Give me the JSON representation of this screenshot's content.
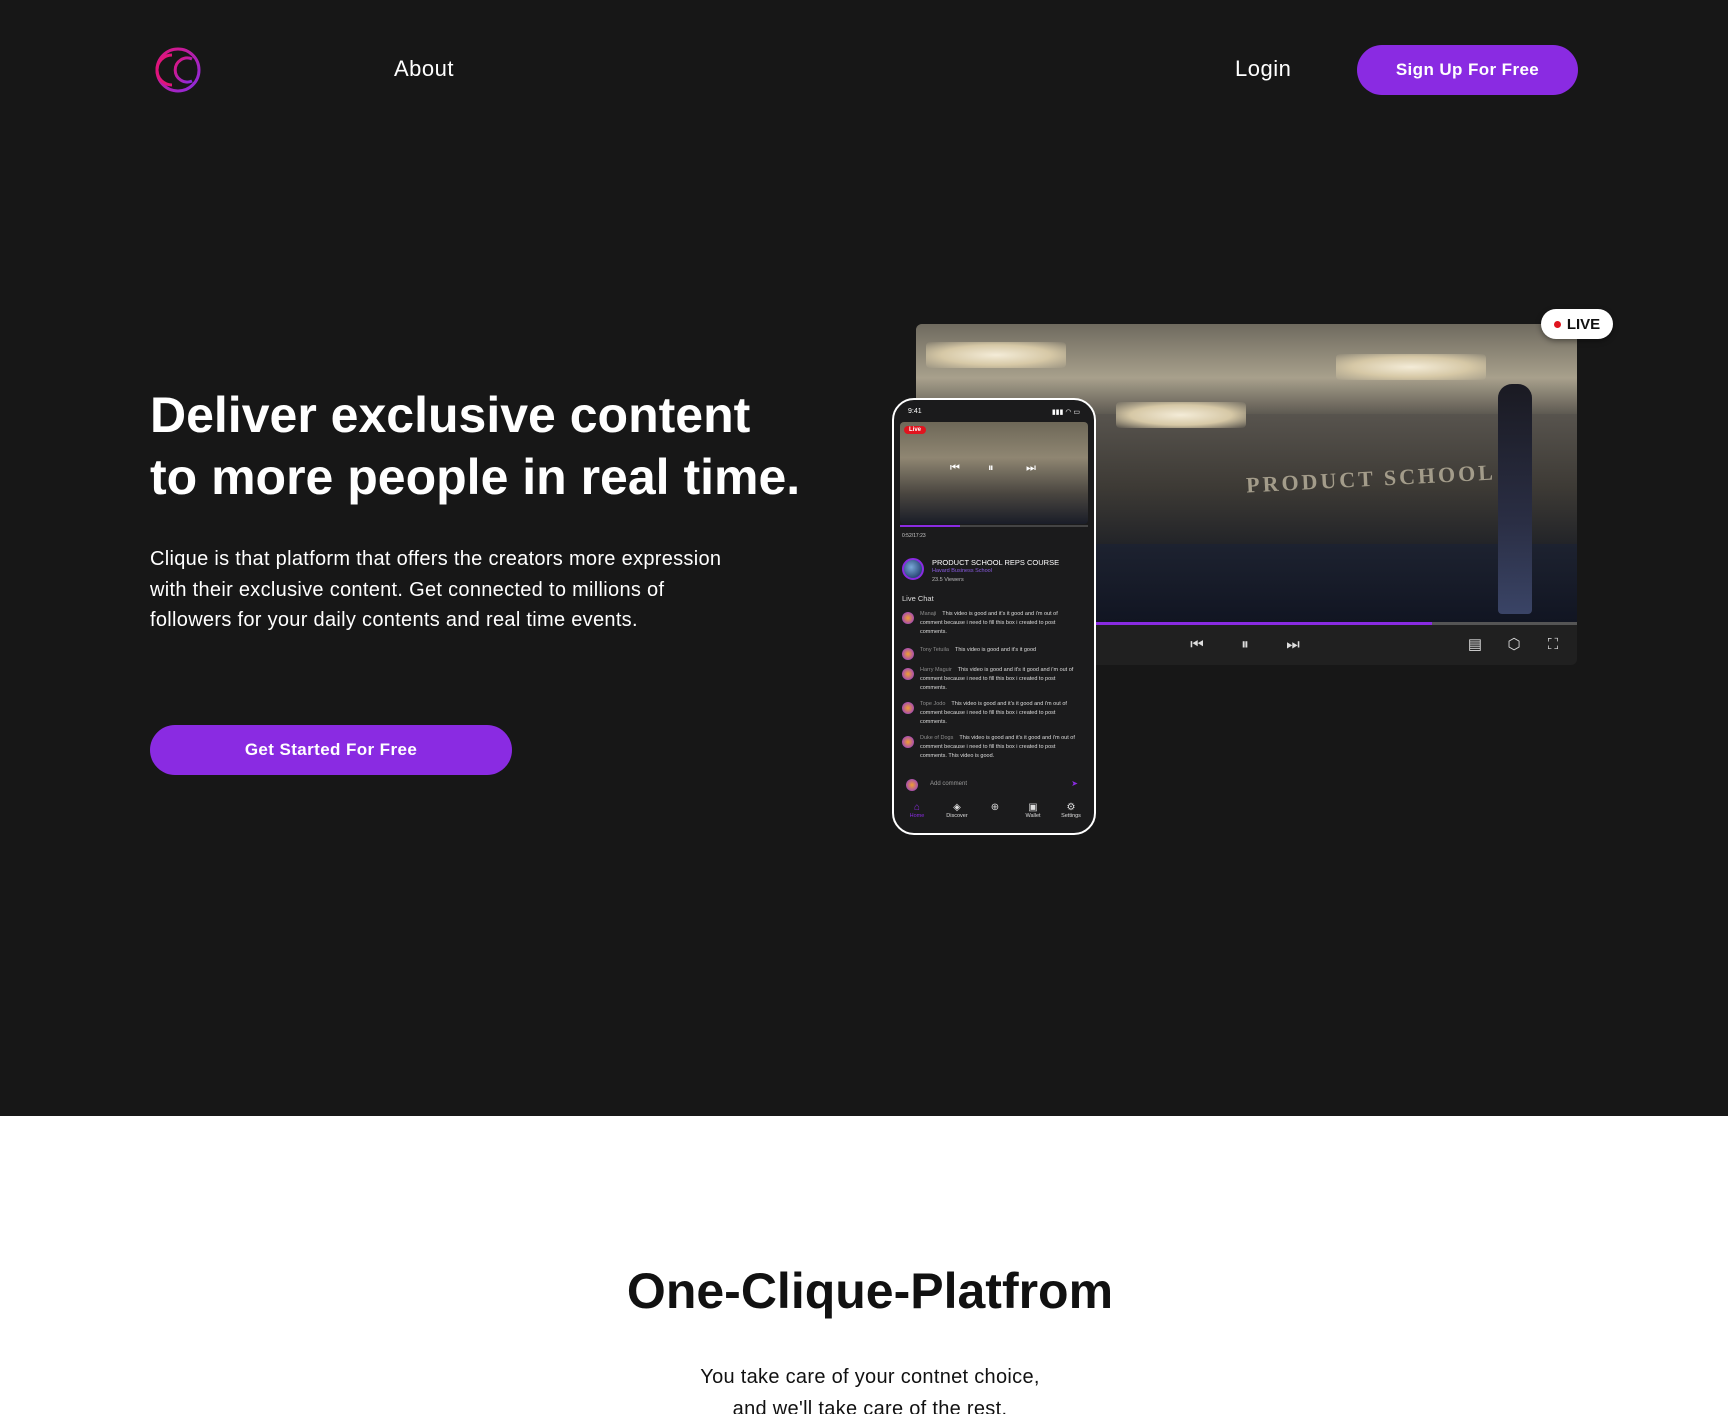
{
  "nav": {
    "about": "About",
    "login": "Login",
    "signup": "Sign Up For Free"
  },
  "hero": {
    "headline_line1": "Deliver exclusive content",
    "headline_line2": "to more people in real time.",
    "description": "Clique is that platform that offers the creators more expression with their exclusive content. Get connected to  millions of followers for your daily contents and real time events.",
    "cta": "Get Started For Free"
  },
  "video": {
    "live_label": "LIVE",
    "wall_text": "PRODUCT SCHOOL",
    "progress": 0.78
  },
  "phone": {
    "time": "9:41",
    "live": "Live",
    "timestamp": "0:52/17:23",
    "course_title": "PRODUCT SCHOOL REPS COURSE",
    "course_sub": "Havard Business School",
    "viewers": "23.5 Viewers",
    "chat_heading": "Live Chat",
    "messages": [
      {
        "name": "Manaji",
        "text": "This video is good and it's it good and i'm out of comment because i need to fill this box i created to post comments."
      },
      {
        "name": "Tony Tetuila",
        "text": "This video is good and it's it good"
      },
      {
        "name": "Harry Maguir",
        "text": "This video is good and it's it good and i'm out of comment because i need to fill this box i created to post comments."
      },
      {
        "name": "Tope Jodo",
        "text": "This video is good and it's it good and i'm out of comment because i need to fill this box i created to post comments."
      },
      {
        "name": "Duke of Dogs",
        "text": "This video is good and it's it good and i'm out of comment because i need to fill this box i created to post comments. This video is good."
      }
    ],
    "comment_placeholder": "Add comment",
    "nav": [
      "Home",
      "Discover",
      "Wallet",
      "Settings"
    ]
  },
  "section2": {
    "title": "One-Clique-Platfrom",
    "sub_line1": "You take care of your contnet choice,",
    "sub_line2": "and we'll take care of the rest."
  },
  "colors": {
    "accent": "#8a2be2",
    "hero_bg": "#171717",
    "live_red": "#e0141e"
  }
}
